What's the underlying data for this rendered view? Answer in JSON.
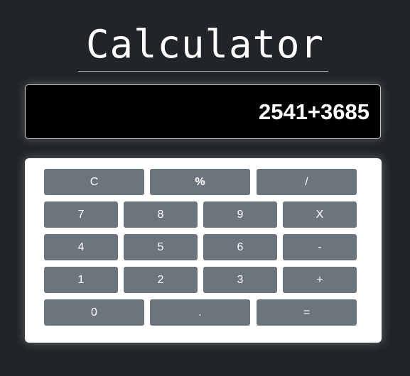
{
  "app": {
    "title": "Calculator"
  },
  "display": {
    "value": "2541+3685"
  },
  "keys": {
    "clear": "C",
    "percent": "%",
    "divide": "/",
    "seven": "7",
    "eight": "8",
    "nine": "9",
    "multiply": "X",
    "four": "4",
    "five": "5",
    "six": "6",
    "subtract": "-",
    "one": "1",
    "two": "2",
    "three": "3",
    "add": "+",
    "zero": "0",
    "decimal": ".",
    "equals": "="
  },
  "colors": {
    "background": "#212529",
    "key": "#6c757d",
    "keypad": "#ffffff",
    "display": "#000000"
  }
}
